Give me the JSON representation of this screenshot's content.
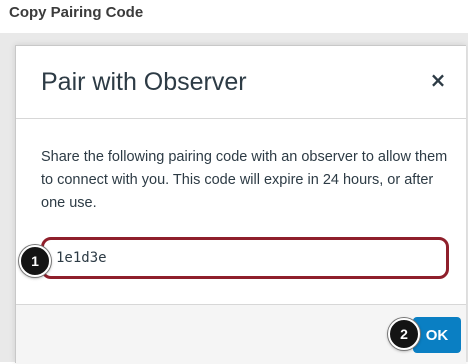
{
  "page": {
    "heading": "Copy Pairing Code"
  },
  "modal": {
    "title": "Pair with Observer",
    "close_label": "×",
    "description": "Share the following pairing code with an observer to allow them to connect with you. This code will expire in 24 hours, or after one use.",
    "pairing_code": "1e1d3e",
    "ok_label": "OK"
  },
  "callouts": {
    "first": "1",
    "second": "2"
  },
  "colors": {
    "accent": "#0a7fc3",
    "highlight_border": "#8f1f2b",
    "callout_bg": "#141414"
  }
}
